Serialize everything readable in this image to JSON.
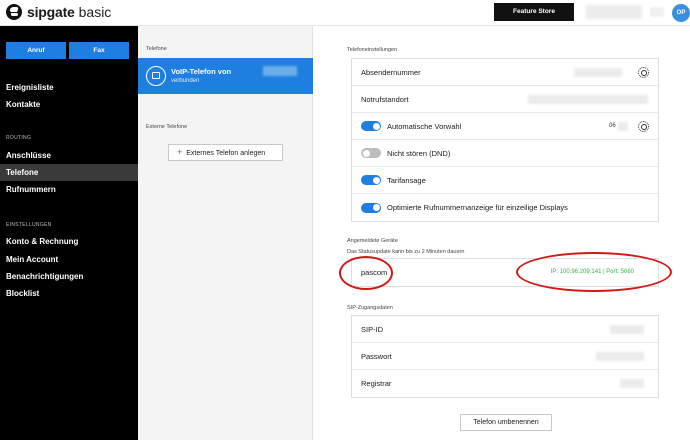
{
  "header": {
    "brand_name": "sipgate",
    "brand_suffix": "basic",
    "feature_store": "Feature Store",
    "avatar_initials": "OP"
  },
  "nav": {
    "quick_actions": [
      "Anruf",
      "Fax"
    ],
    "items_top": [
      "Ereignisliste",
      "Kontakte"
    ],
    "routing_title": "ROUTING",
    "routing_items": [
      "Anschlüsse",
      "Telefone",
      "Rufnummern"
    ],
    "active_item": "Telefone",
    "settings_title": "EINSTELLUNGEN",
    "settings_items": [
      "Konto & Rechnung",
      "Mein Account",
      "Benachrichtigungen",
      "Blocklist"
    ]
  },
  "phones_panel": {
    "title": "Telefone",
    "selected_phone": {
      "name": "VoIP-Telefon von",
      "status": "verbunden"
    },
    "external_title": "Externe Telefone",
    "add_external": "Externes Telefon anlegen"
  },
  "settings": {
    "title": "Telefoneinstellungen",
    "rows": {
      "absender": "Absendernummer",
      "notruf": "Notrufstandort",
      "vorwahl": "Automatische Vorwahl",
      "vorwahl_value": "06",
      "dnd": "Nicht stören (DND)",
      "tarif": "Tarifansage",
      "display": "Optimierte Rufnummernanzeige für einzeilige Displays"
    },
    "toggles": {
      "vorwahl": true,
      "dnd": false,
      "tarif": true,
      "display": true
    }
  },
  "devices": {
    "title": "Angemeldete Geräte",
    "subtitle": "Das Statusupdate kann bis zu 2 Minuten dauern",
    "device_name": "pascom",
    "device_ip": "IP: 100.96.209.141 | Port: 5060"
  },
  "sip": {
    "title": "SIP-Zugangsdaten",
    "sip_id": "SIP-ID",
    "password": "Passwort",
    "registrar": "Registrar"
  },
  "rename_button": "Telefon umbenennen",
  "colors": {
    "accent": "#1f7fe0",
    "nav_bg": "#000000",
    "status_green": "#35b34a",
    "annotation_red": "#d31818"
  }
}
